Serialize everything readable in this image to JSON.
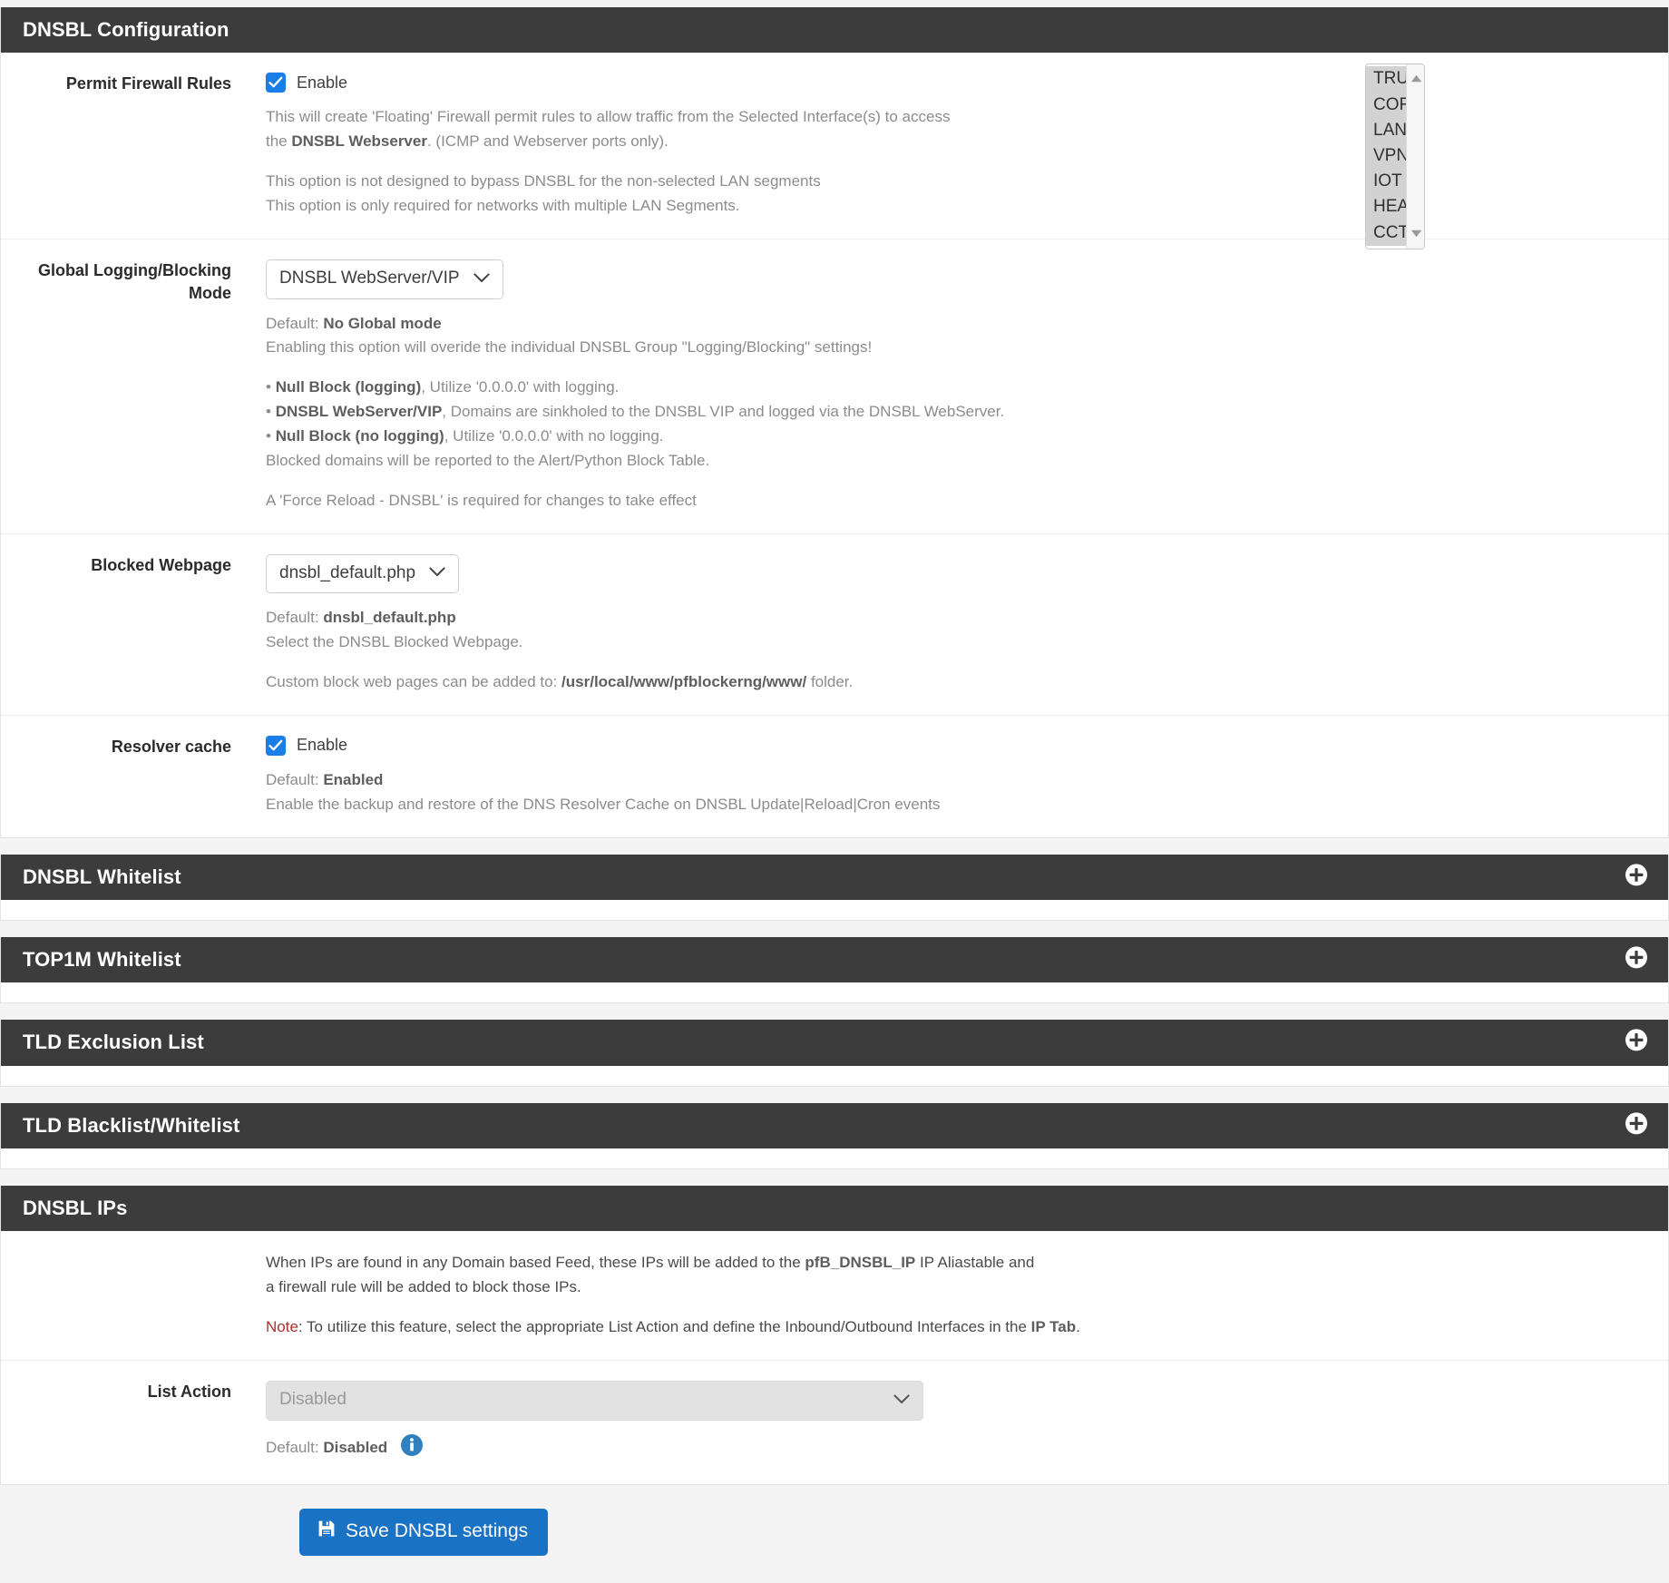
{
  "sections": {
    "config": {
      "title": "DNSBL Configuration",
      "permit_rules": {
        "label": "Permit Firewall Rules",
        "checkbox_label": "Enable",
        "checked": true,
        "help_line1_a": "This will create 'Floating' Firewall permit rules to allow traffic from the Selected Interface(s) to access",
        "help_line2_a": "the ",
        "help_line2_b": "DNSBL Webserver",
        "help_line2_c": ". (ICMP and Webserver ports only).",
        "help_line3": "This option is not designed to bypass DNSBL for the non-selected LAN segments",
        "help_line4": "This option is only required for networks with multiple LAN Segments.",
        "interfaces": [
          {
            "label": "TRUNK",
            "selected": true
          },
          {
            "label": "CORE",
            "selected": true
          },
          {
            "label": "LAN",
            "selected": true
          },
          {
            "label": "VPN",
            "selected": true
          },
          {
            "label": "IOT",
            "selected": true
          },
          {
            "label": "HEATH",
            "selected": true
          },
          {
            "label": "CCTV",
            "selected": true
          }
        ]
      },
      "global_mode": {
        "label_line1": "Global Logging/Blocking",
        "label_line2": "Mode",
        "value": "DNSBL WebServer/VIP",
        "options": [
          "No Global mode",
          "Null Block (logging)",
          "DNSBL WebServer/VIP",
          "Null Block (no logging)"
        ],
        "default_prefix": "Default: ",
        "default_value": "No Global mode",
        "help_override": "Enabling this option will overide the individual DNSBL Group \"Logging/Blocking\" settings!",
        "bullets": [
          {
            "bold": "Null Block (logging)",
            "rest": ", Utilize '0.0.0.0' with logging."
          },
          {
            "bold": "DNSBL WebServer/VIP",
            "rest": ", Domains are sinkholed to the DNSBL VIP and logged via the DNSBL WebServer."
          },
          {
            "bold": "Null Block (no logging)",
            "rest": ", Utilize '0.0.0.0' with no logging."
          }
        ],
        "help_block_table": "Blocked domains will be reported to the Alert/Python Block Table.",
        "help_force_reload": "A 'Force Reload - DNSBL' is required for changes to take effect"
      },
      "blocked_webpage": {
        "label": "Blocked Webpage",
        "value": "dnsbl_default.php",
        "options": [
          "dnsbl_default.php"
        ],
        "default_prefix": "Default: ",
        "default_value": "dnsbl_default.php",
        "help_select": "Select the DNSBL Blocked Webpage.",
        "help_custom_a": "Custom block web pages can be added to: ",
        "help_custom_path": "/usr/local/www/pfblockerng/www/",
        "help_custom_b": " folder."
      },
      "resolver_cache": {
        "label": "Resolver cache",
        "checkbox_label": "Enable",
        "checked": true,
        "default_prefix": "Default: ",
        "default_value": "Enabled",
        "help": "Enable the backup and restore of the DNS Resolver Cache on DNSBL Update|Reload|Cron events"
      }
    },
    "collapsed": [
      {
        "title": "DNSBL Whitelist",
        "icon": "plus-circle-icon"
      },
      {
        "title": "TOP1M Whitelist",
        "icon": "plus-circle-icon"
      },
      {
        "title": "TLD Exclusion List",
        "icon": "plus-circle-icon"
      },
      {
        "title": "TLD Blacklist/Whitelist",
        "icon": "plus-circle-icon"
      }
    ],
    "dnsbl_ips": {
      "title": "DNSBL IPs",
      "intro_a": "When IPs are found in any Domain based Feed, these IPs will be added to the ",
      "intro_bold": "pfB_DNSBL_IP",
      "intro_b": " IP Aliastable and",
      "intro_line2": "a firewall rule will be added to block those IPs.",
      "note_label": "Note",
      "note_a": ": To utilize this feature, select the appropriate List Action and define the Inbound/Outbound Interfaces in the ",
      "note_bold": "IP Tab",
      "note_b": ".",
      "list_action": {
        "label": "List Action",
        "value": "Disabled",
        "options": [
          "Disabled"
        ],
        "disabled": true,
        "default_prefix": "Default: ",
        "default_value": "Disabled",
        "info_icon": "info-circle-icon"
      }
    }
  },
  "footer": {
    "save_button": "Save DNSBL settings",
    "save_icon": "save-floppy-icon"
  },
  "colors": {
    "header_bar": "#3c3c3c",
    "accent_blue": "#1a72c4",
    "checkbox_blue": "#1a7ee8",
    "note_red": "#b03030",
    "page_bg": "#f4f4f4"
  }
}
